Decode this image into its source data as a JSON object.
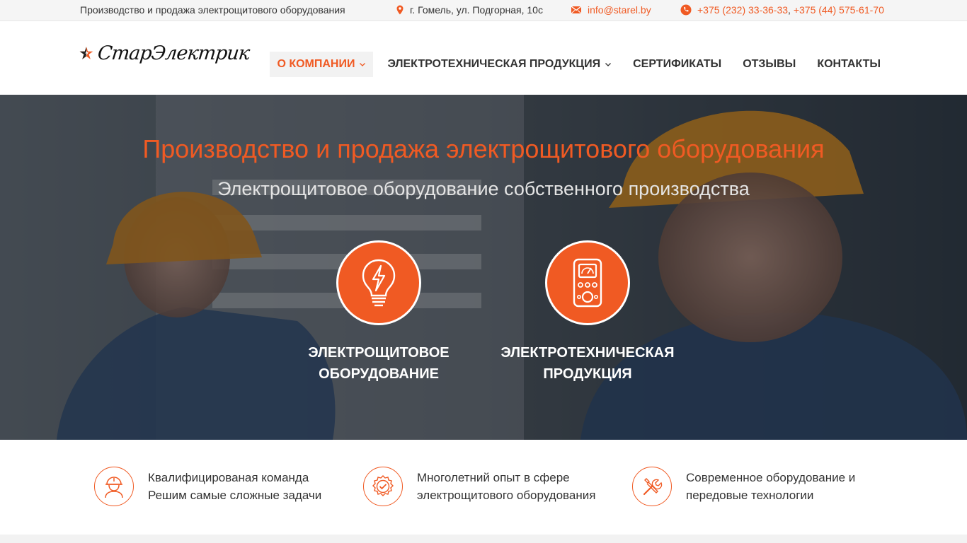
{
  "topbar": {
    "tagline": "Производство и продажа электрощитового оборудования",
    "address": "г. Гомель, ул. Подгорная, 10с",
    "email": "info@starel.by",
    "phone1": "+375 (232) 33-36-33",
    "separator": ",",
    "phone2": "+375 (44) 575-61-70"
  },
  "logo": {
    "text": "СтарЭлектрик"
  },
  "nav": {
    "items": [
      {
        "label": "О компании",
        "active": true,
        "dropdown": true
      },
      {
        "label": "Электротехническая продукция",
        "active": false,
        "dropdown": true
      },
      {
        "label": "Сертификаты",
        "active": false,
        "dropdown": false
      },
      {
        "label": "Отзывы",
        "active": false,
        "dropdown": false
      },
      {
        "label": "Контакты",
        "active": false,
        "dropdown": false
      }
    ]
  },
  "hero": {
    "title": "Производство и продажа электрощитового оборудования",
    "subtitle": "Электрощитовое оборудование собственного производства",
    "features": [
      {
        "line1": "Электрощитовое",
        "line2": "оборудование",
        "icon": "lightbulb-bolt-icon"
      },
      {
        "line1": "Электротехническая",
        "line2": "продукция",
        "icon": "multimeter-icon"
      }
    ]
  },
  "benefits": [
    {
      "line1": "Квалифицированая команда",
      "line2": "Решим самые сложные задачи",
      "icon": "worker-helmet-icon"
    },
    {
      "line1": "Многолетний опыт в сфере",
      "line2": "электрощитового оборудования",
      "icon": "badge-check-icon"
    },
    {
      "line1": "Современное оборудование и",
      "line2": "передовые технологии",
      "icon": "tools-icon"
    }
  ],
  "colors": {
    "accent": "#f05a23",
    "topbar_bg": "#f5f5f5",
    "text": "#333333"
  }
}
